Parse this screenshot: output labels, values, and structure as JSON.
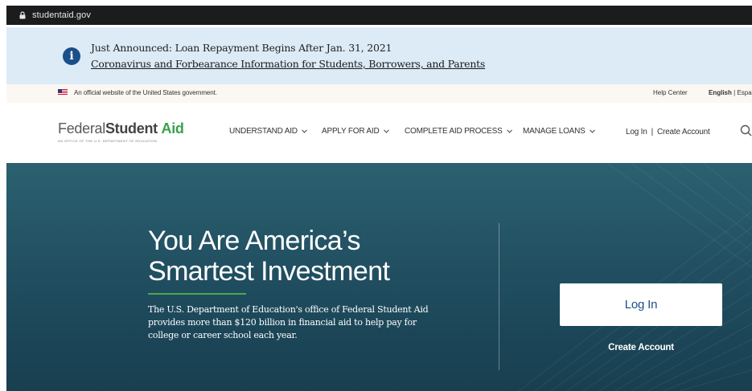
{
  "browser": {
    "url": "studentaid.gov"
  },
  "banner": {
    "headline": "Just Announced: Loan Repayment Begins After Jan. 31, 2021",
    "link": "Coronavirus and Forbearance Information for Students, Borrowers, and Parents",
    "icon": "info-icon"
  },
  "gov_strip": {
    "official": "An official website of the United States government.",
    "help_center": "Help Center",
    "lang_current": "English",
    "lang_separator": "|",
    "lang_other": "Espa"
  },
  "nav": {
    "logo_federal": "Federal",
    "logo_student": "Student",
    "logo_aid": "Aid",
    "logo_tagline": "AN OFFICE OF THE U.S. DEPARTMENT OF EDUCATION",
    "items": [
      {
        "label": "UNDERSTAND AID"
      },
      {
        "label": "APPLY FOR AID"
      },
      {
        "label": "COMPLETE AID PROCESS"
      },
      {
        "label": "MANAGE LOANS"
      }
    ],
    "login": "Log In",
    "separator": "|",
    "create_account": "Create Account"
  },
  "hero": {
    "title_line1": "You Are America’s",
    "title_line2": "Smartest Investment",
    "description": "The U.S. Department of Education's office of Federal Student Aid provides more than $120 billion in financial aid to help pay for college or career school each year.",
    "login_button": "Log In",
    "create_account": "Create Account"
  },
  "colors": {
    "hero_bg": "#1f4c5e",
    "banner_bg": "#dcebf6",
    "brand_green": "#3aa04a",
    "brand_blue": "#1b4f8a"
  }
}
